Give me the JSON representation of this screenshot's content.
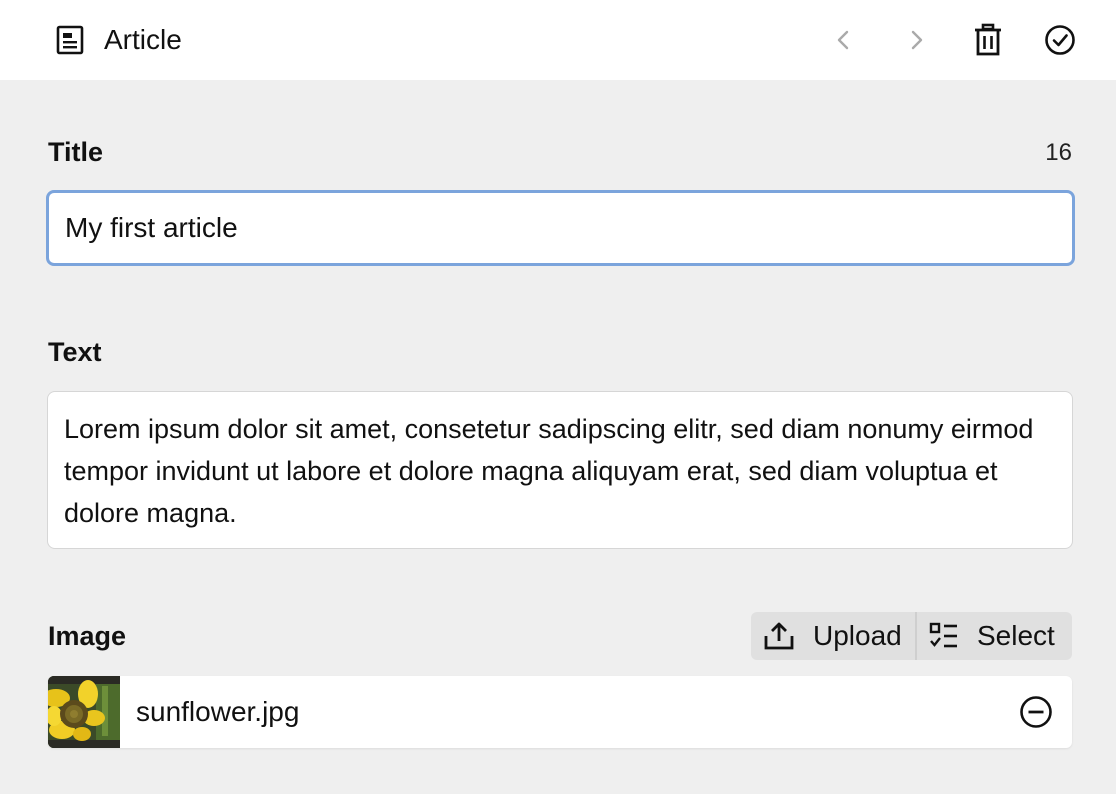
{
  "header": {
    "title": "Article",
    "icons": {
      "document": "document-icon",
      "prev": "chevron-left-icon",
      "next": "chevron-right-icon",
      "delete": "trash-icon",
      "done": "check-circle-icon"
    }
  },
  "form": {
    "title_field": {
      "label": "Title",
      "value": "My first article",
      "char_count": "16"
    },
    "text_field": {
      "label": "Text",
      "value": "Lorem ipsum dolor sit amet, consetetur sadipscing elitr, sed diam nonumy eirmod tempor invidunt ut labore et dolore magna aliquyam erat, sed diam voluptua et dolore magna."
    },
    "image_field": {
      "label": "Image",
      "upload_label": "Upload",
      "select_label": "Select",
      "file": {
        "name": "sunflower.jpg"
      }
    }
  },
  "colors": {
    "background": "#efefef",
    "surface": "#ffffff",
    "focus_border": "#7ba4dc",
    "disabled_icon": "#aaaaaa"
  }
}
